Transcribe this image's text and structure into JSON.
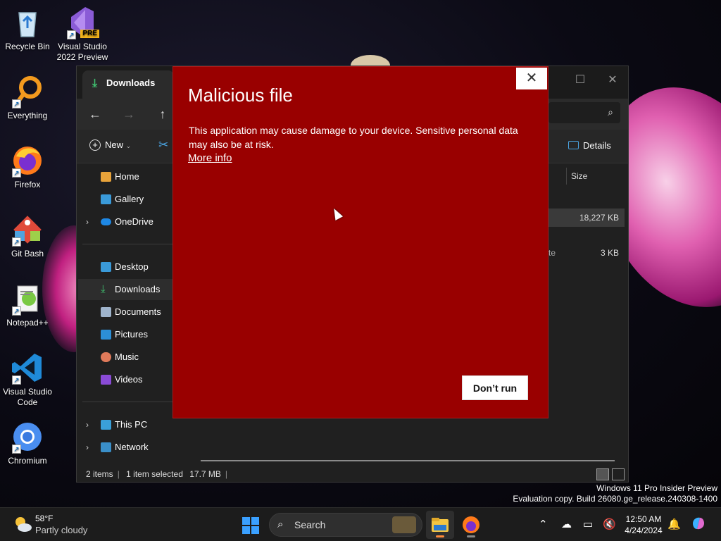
{
  "desktop": {
    "icons": [
      {
        "label": "Recycle Bin",
        "icon": "recycle-bin-icon"
      },
      {
        "label": "Visual Studio 2022 Preview",
        "icon": "visual-studio-icon",
        "badge": "PRE"
      },
      {
        "label": "Everything",
        "icon": "everything-search-icon"
      },
      {
        "label": "Firefox",
        "icon": "firefox-icon"
      },
      {
        "label": "Git Bash",
        "icon": "git-bash-icon"
      },
      {
        "label": "Notepad++",
        "icon": "notepad-plus-plus-icon"
      },
      {
        "label": "Visual Studio Code",
        "icon": "vscode-icon"
      },
      {
        "label": "Chromium",
        "icon": "chromium-icon"
      }
    ],
    "watermark": {
      "line1": "Windows 11 Pro Insider Preview",
      "line2": "Evaluation copy. Build 26080.ge_release.240308-1400"
    }
  },
  "explorer": {
    "tab_title": "Downloads",
    "commands": {
      "new_label": "New",
      "details_label": "Details"
    },
    "sidebar": {
      "home": "Home",
      "gallery": "Gallery",
      "onedrive": "OneDrive",
      "desktop": "Desktop",
      "downloads": "Downloads",
      "documents": "Documents",
      "pictures": "Pictures",
      "music": "Music",
      "videos": "Videos",
      "thispc": "This PC",
      "network": "Network"
    },
    "columns": {
      "size": "Size"
    },
    "files": [
      {
        "size": "18,227 KB"
      },
      {
        "type_fragment": "te",
        "size": "3 KB"
      }
    ],
    "status": {
      "items": "2 items",
      "selected": "1 item selected",
      "selected_size": "17.7 MB"
    }
  },
  "dialog": {
    "title": "Malicious file",
    "message": "This application may cause damage to your device. Sensitive personal data may also be at risk.",
    "more_info": "More info",
    "dont_run": "Don’t run",
    "bg_color": "#990000"
  },
  "taskbar": {
    "weather": {
      "temp": "58°F",
      "desc": "Partly cloudy"
    },
    "search_label": "Search",
    "clock": {
      "time": "12:50 AM",
      "date": "4/24/2024"
    }
  }
}
